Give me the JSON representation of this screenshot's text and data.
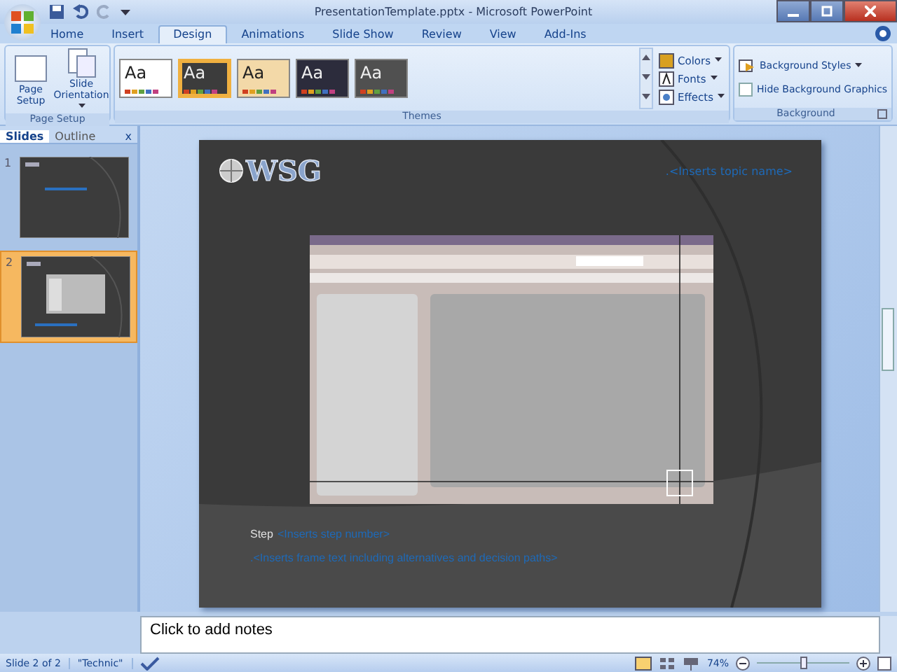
{
  "window": {
    "title": "PresentationTemplate.pptx - Microsoft PowerPoint"
  },
  "ribbon_tabs": [
    {
      "label": "Home",
      "selected": false
    },
    {
      "label": "Insert",
      "selected": false
    },
    {
      "label": "Design",
      "selected": true
    },
    {
      "label": "Animations",
      "selected": false
    },
    {
      "label": "Slide Show",
      "selected": false
    },
    {
      "label": "Review",
      "selected": false
    },
    {
      "label": "View",
      "selected": false
    },
    {
      "label": "Add-Ins",
      "selected": false
    }
  ],
  "page_setup": {
    "buttons": [
      "Page Setup",
      "Slide Orientation"
    ],
    "group": "Page Setup"
  },
  "themes": {
    "items": [
      {
        "sample": "Aa",
        "selected": false,
        "color": "#ffffff"
      },
      {
        "sample": "Aa",
        "selected": true,
        "color": "#3c3c3c"
      },
      {
        "sample": "Aa",
        "selected": false,
        "color": "#f3d9a8"
      },
      {
        "sample": "Aa",
        "selected": false,
        "color": "#2c2c3c"
      },
      {
        "sample": "Aa",
        "selected": false,
        "color": "#505050"
      }
    ],
    "options": [
      "Colors",
      "Fonts",
      "Effects"
    ],
    "group": "Themes"
  },
  "background": {
    "styles": "Background Styles",
    "hide_graphics": {
      "label": "Hide Background Graphics",
      "checked": false
    },
    "group": "Background"
  },
  "panel_tabs": [
    {
      "label": "Slides",
      "selected": true
    },
    {
      "label": "Outline",
      "selected": false
    }
  ],
  "panel_close": "x",
  "thumbnails": [
    {
      "number": "1",
      "selected": false
    },
    {
      "number": "2",
      "selected": true
    }
  ],
  "slide": {
    "logo": "WSG",
    "topic": ".<Inserts topic name>",
    "step_label": "Step",
    "step_value": "<Inserts step number>",
    "frame_text": ".<Inserts frame text including alternatives and decision paths>"
  },
  "notes": {
    "placeholder": "Click to add notes"
  },
  "status_bar": {
    "slide": "Slide 2 of 2",
    "theme": "\"Technic\"",
    "zoom": "74%",
    "zoom_slider": {
      "level": 0.5
    }
  }
}
